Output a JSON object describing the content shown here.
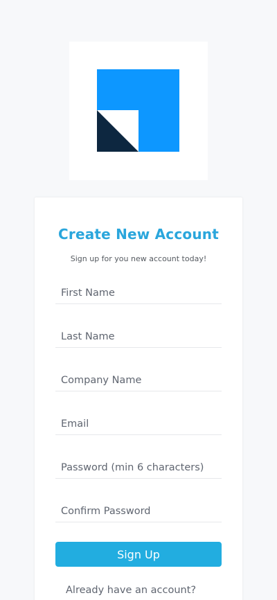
{
  "colors": {
    "logo_blue": "#0d97ff",
    "logo_dark": "#0d2740",
    "title": "#2aa6dc",
    "button": "#22ade0",
    "background": "#f7f8fa"
  },
  "logo": {
    "icon": "brand-logo-icon"
  },
  "form": {
    "title": "Create New Account",
    "subtitle": "Sign up for you new account today!",
    "fields": [
      {
        "placeholder": "First Name",
        "value": ""
      },
      {
        "placeholder": "Last Name",
        "value": ""
      },
      {
        "placeholder": "Company Name",
        "value": ""
      },
      {
        "placeholder": "Email",
        "value": ""
      },
      {
        "placeholder": "Password (min 6 characters)",
        "value": ""
      },
      {
        "placeholder": "Confirm Password",
        "value": ""
      }
    ],
    "submit_label": "Sign Up",
    "signin_prompt": "Already have an account?"
  }
}
